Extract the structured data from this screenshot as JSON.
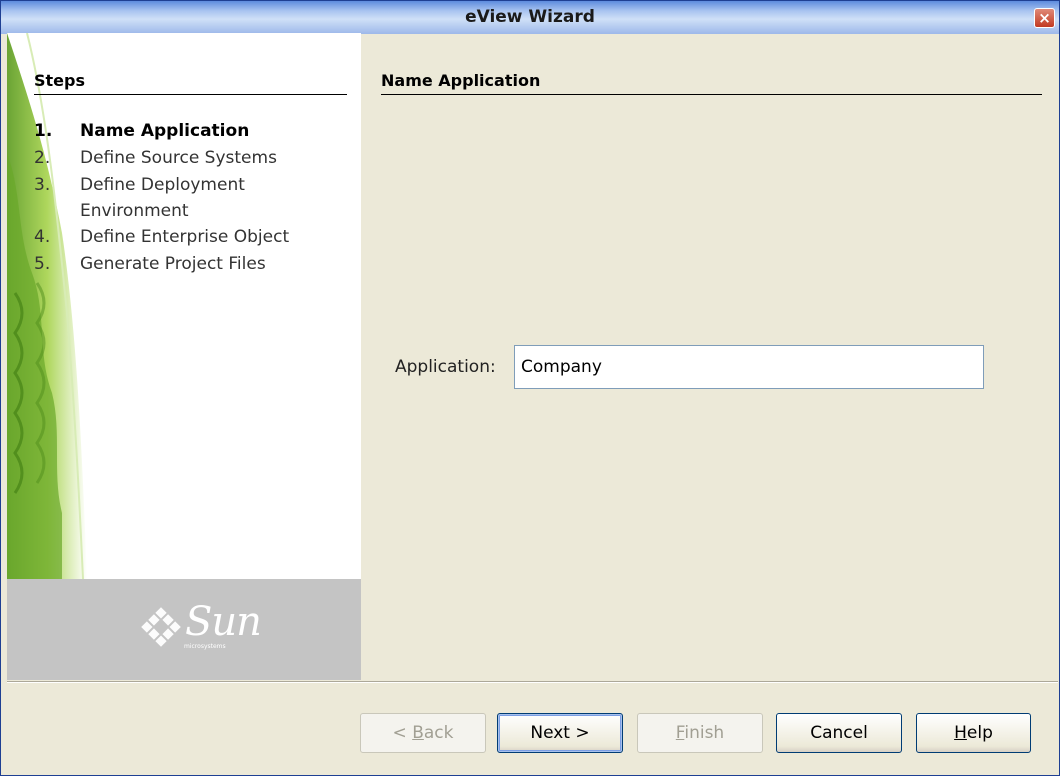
{
  "window": {
    "title": "eView Wizard",
    "close_label": "×"
  },
  "steps": {
    "heading": "Steps",
    "items": [
      {
        "num": "1.",
        "label": "Name Application",
        "active": true
      },
      {
        "num": "2.",
        "label": "Define Source Systems",
        "active": false
      },
      {
        "num": "3.",
        "label": "Define Deployment Environment",
        "active": false
      },
      {
        "num": "4.",
        "label": "Define Enterprise Object",
        "active": false
      },
      {
        "num": "5.",
        "label": "Generate Project Files",
        "active": false
      }
    ]
  },
  "branding": {
    "logo_text": "Sun",
    "logo_subtext": "microsystems"
  },
  "content": {
    "heading": "Name Application",
    "application_label": "Application:",
    "application_value": "Company"
  },
  "buttons": {
    "back": {
      "label": "< Back",
      "mnemonic": "B",
      "enabled": false
    },
    "next": {
      "label": "Next >",
      "enabled": true
    },
    "finish": {
      "label": "Finish",
      "mnemonic": "F",
      "enabled": false
    },
    "cancel": {
      "label": "Cancel",
      "enabled": true
    },
    "help": {
      "label": "Help",
      "mnemonic": "H",
      "enabled": true
    }
  },
  "colors": {
    "titlebar": "#a9c4f0",
    "dialog_bg": "#ece9d8",
    "leaf_green": "#8cc63f",
    "logo_panel": "#c4c4c4"
  }
}
